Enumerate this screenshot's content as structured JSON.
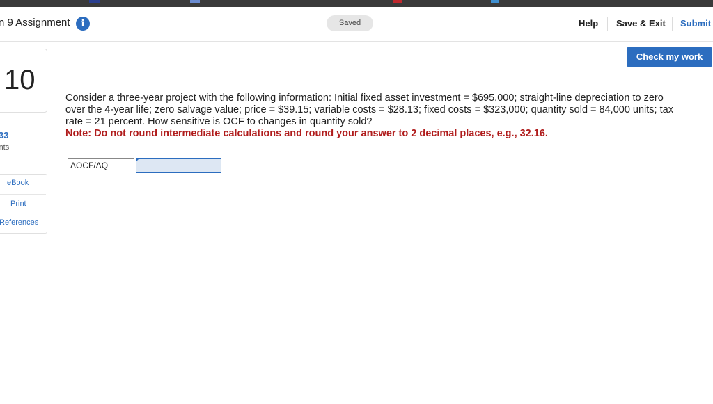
{
  "header": {
    "title": "n 9 Assignment",
    "saved": "Saved",
    "help": "Help",
    "save_exit": "Save & Exit",
    "submit": "Submit"
  },
  "check_work": "Check my work",
  "question": {
    "number": "10",
    "points_value": "33",
    "points_label": "oints",
    "text": "Consider a three-year project with the following information: Initial fixed asset investment = $695,000; straight-line depreciation to zero over the 4-year life; zero salvage value; price = $39.15; variable costs = $28.13; fixed costs = $323,000; quantity sold = 84,000 units; tax rate = 21 percent. How sensitive is OCF to changes in quantity sold?",
    "note": "Note: Do not round intermediate calculations and round your answer to 2 decimal places, e.g., 32.16."
  },
  "answer": {
    "label": "ΔOCF/ΔQ",
    "value": ""
  },
  "sidebar": {
    "ebook": "eBook",
    "print": "Print",
    "references": "References"
  },
  "colors": {
    "accent": "#2c6dbf",
    "note": "#b01c1c"
  }
}
